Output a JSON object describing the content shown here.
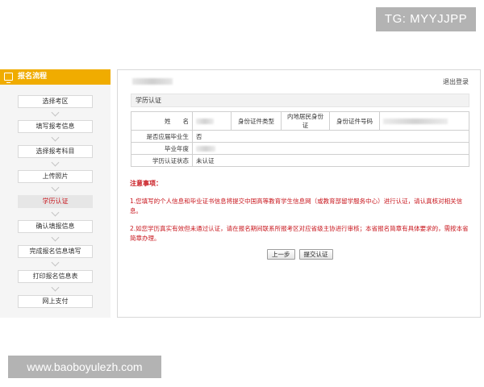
{
  "watermark": {
    "top": "TG: MYYJJPP",
    "bottom": "www.baoboyulezh.com"
  },
  "sidebar": {
    "title": "报名流程",
    "steps": [
      {
        "label": "选择考区",
        "active": false
      },
      {
        "label": "填写报考信息",
        "active": false
      },
      {
        "label": "选择报考科目",
        "active": false
      },
      {
        "label": "上传照片",
        "active": false
      },
      {
        "label": "学历认证",
        "active": true
      },
      {
        "label": "确认填报信息",
        "active": false
      },
      {
        "label": "完成报名信息填写",
        "active": false
      },
      {
        "label": "打印报名信息表",
        "active": false
      },
      {
        "label": "网上支付",
        "active": false
      }
    ]
  },
  "main": {
    "logout": "退出登录",
    "section_title": "学历认证",
    "table": {
      "name_label": "姓　　名",
      "id_type_label": "身份证件类型",
      "id_type_value": "内地居民身份证",
      "id_number_label": "身份证件号码",
      "graduate_label": "是否应届毕业生",
      "graduate_value": "否",
      "grad_year_label": "毕业年度",
      "status_label": "学历认证状态",
      "status_value": "未认证"
    },
    "notes_title": "注意事项：",
    "notes": [
      "1.您填写的个人信息和毕业证书信息将提交中国高等教育学生信息网（或教育部留学服务中心）进行认证，请认真核对相关信息。",
      "2.如您学历真实有效但未通过认证，请在报名期间联系所报考区对应省级主协进行审核；本省报名简章有具体要求的，需按本省简章办理。"
    ],
    "buttons": {
      "prev": "上一步",
      "submit": "提交认证"
    }
  }
}
